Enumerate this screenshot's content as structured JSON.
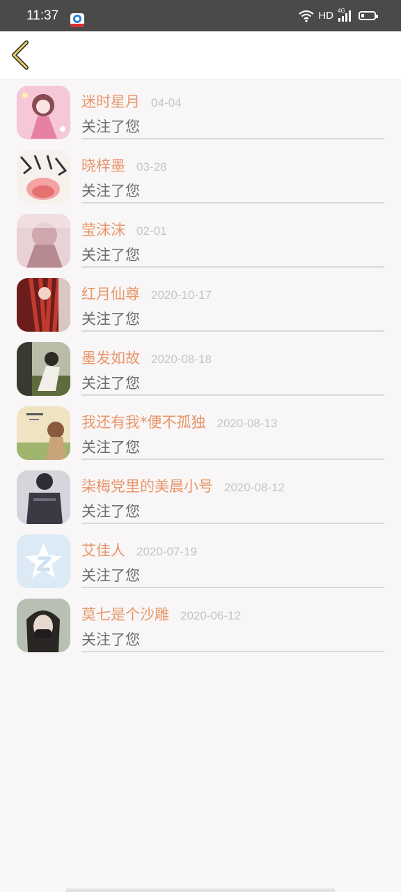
{
  "status_bar": {
    "time": "11:37",
    "network_hd": "HD",
    "network_type": "4G",
    "icons": [
      "app-notification-icon",
      "wifi-icon",
      "signal-icon",
      "battery-icon"
    ]
  },
  "header": {
    "back_icon": "chevron-left-icon",
    "accent": "#e7d06a"
  },
  "colors": {
    "name": "#e89669",
    "date": "#c5c5c5",
    "action": "#6b6b6b"
  },
  "followers": [
    {
      "name": "迷时星月",
      "date": "04-04",
      "action": "关注了您"
    },
    {
      "name": "晓梓墨",
      "date": "03-28",
      "action": "关注了您"
    },
    {
      "name": "莹沫沫",
      "date": "02-01",
      "action": "关注了您"
    },
    {
      "name": "红月仙尊",
      "date": "2020-10-17",
      "action": "关注了您"
    },
    {
      "name": "墨发如故",
      "date": "2020-08-18",
      "action": "关注了您"
    },
    {
      "name": "我还有我*便不孤独",
      "date": "2020-08-13",
      "action": "关注了您"
    },
    {
      "name": "柒梅党里的美晨小号",
      "date": "2020-08-12",
      "action": "关注了您"
    },
    {
      "name": "艾佳人",
      "date": "2020-07-19",
      "action": "关注了您"
    },
    {
      "name": "莫七是个沙雕",
      "date": "2020-06-12",
      "action": "关注了您"
    }
  ]
}
